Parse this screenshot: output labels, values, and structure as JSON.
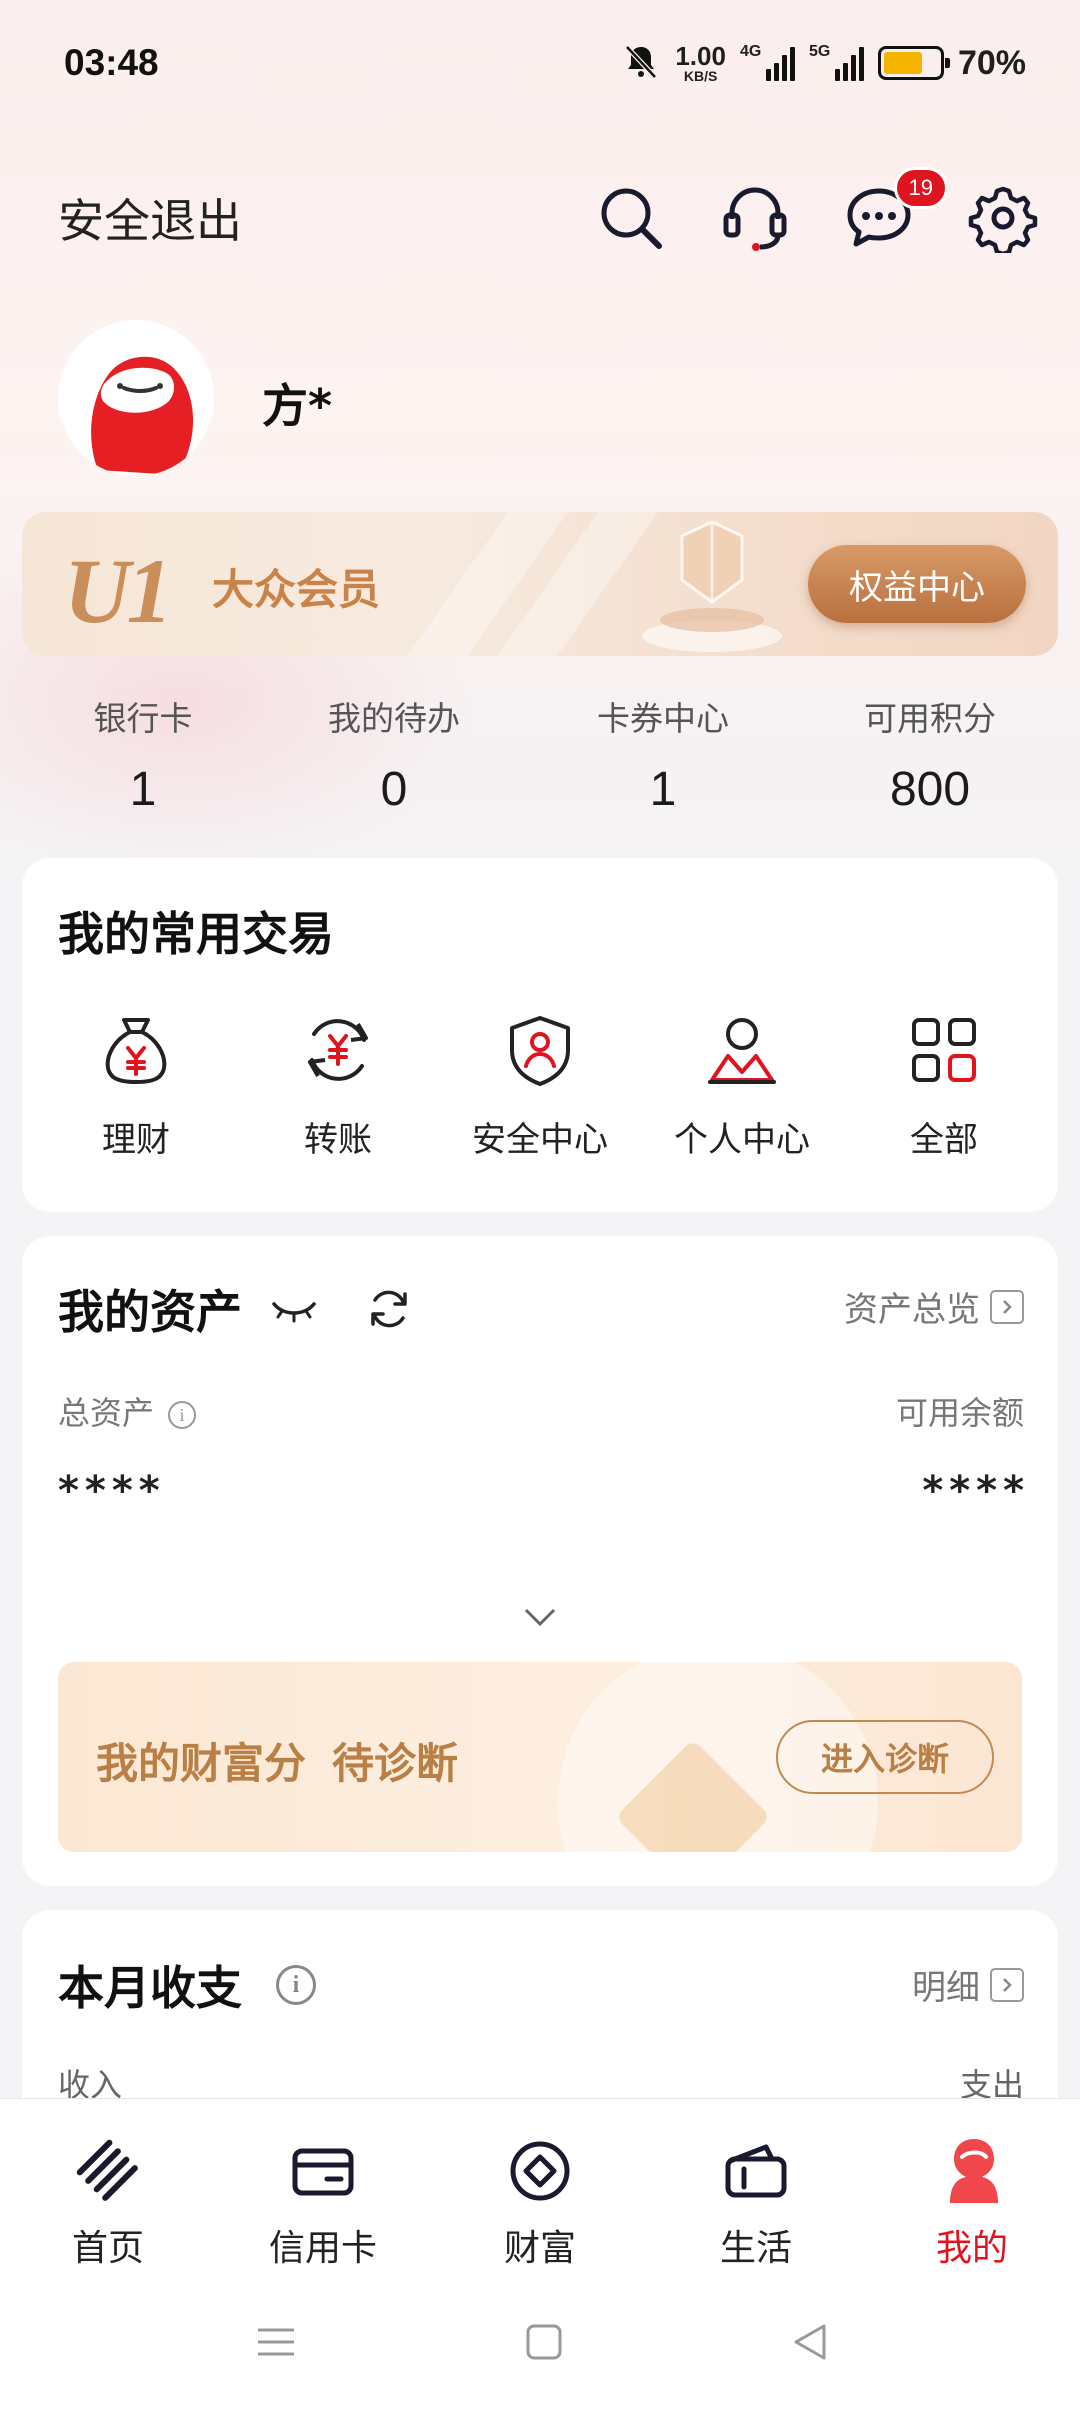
{
  "status_bar": {
    "time": "03:48",
    "net_speed_value": "1.00",
    "net_speed_unit": "KB/S",
    "signal1_tag": "4G",
    "signal2_tag": "5G",
    "battery_level": 0.7,
    "battery_text": "70%",
    "battery_color": "#f4b400"
  },
  "header": {
    "logout_label": "安全退出",
    "message_badge": "19"
  },
  "profile": {
    "name": "方*"
  },
  "membership": {
    "tier_logo": "U1",
    "tier_name": "大众会员",
    "button_label": "权益中心"
  },
  "stats": [
    {
      "label": "银行卡",
      "value": "1"
    },
    {
      "label": "我的待办",
      "value": "0"
    },
    {
      "label": "卡券中心",
      "value": "1"
    },
    {
      "label": "可用积分",
      "value": "800"
    }
  ],
  "quick_actions": {
    "title": "我的常用交易",
    "items": [
      {
        "label": "理财",
        "icon": "money-bag-icon"
      },
      {
        "label": "转账",
        "icon": "transfer-icon"
      },
      {
        "label": "安全中心",
        "icon": "shield-icon"
      },
      {
        "label": "个人中心",
        "icon": "person-icon"
      },
      {
        "label": "全部",
        "icon": "grid-icon"
      }
    ]
  },
  "assets": {
    "title": "我的资产",
    "overview_link": "资产总览",
    "total_label": "总资产",
    "available_label": "可用余额",
    "total_value": "****",
    "available_value": "****"
  },
  "wealth_score": {
    "title": "我的财富分",
    "status": "待诊断",
    "button_label": "进入诊断"
  },
  "monthly": {
    "title": "本月收支",
    "detail_link": "明细",
    "income_label": "收入",
    "expense_label": "支出"
  },
  "bottom_nav": [
    {
      "label": "首页",
      "icon": "home-icon"
    },
    {
      "label": "信用卡",
      "icon": "credit-card-icon"
    },
    {
      "label": "财富",
      "icon": "wealth-icon"
    },
    {
      "label": "生活",
      "icon": "wallet-icon"
    },
    {
      "label": "我的",
      "icon": "profile-icon",
      "active": true
    }
  ],
  "colors": {
    "brand_red": "#e0141e",
    "gold": "#c98e5a"
  }
}
